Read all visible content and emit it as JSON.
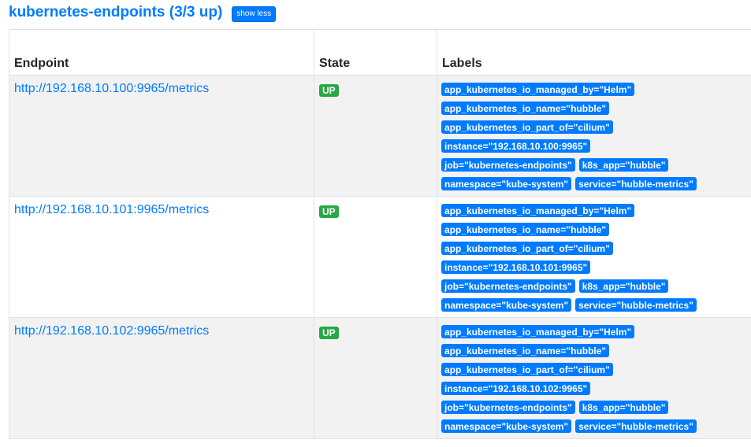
{
  "job": {
    "title": "kubernetes-endpoints (3/3 up)",
    "toggle_label": "show less"
  },
  "table": {
    "headers": {
      "endpoint": "Endpoint",
      "state": "State",
      "labels": "Labels"
    },
    "rows": [
      {
        "endpoint": "http://192.168.10.100:9965/metrics",
        "state": "UP",
        "labels": [
          "app_kubernetes_io_managed_by=\"Helm\"",
          "app_kubernetes_io_name=\"hubble\"",
          "app_kubernetes_io_part_of=\"cilium\"",
          "instance=\"192.168.10.100:9965\"",
          "job=\"kubernetes-endpoints\"",
          "k8s_app=\"hubble\"",
          "namespace=\"kube-system\"",
          "service=\"hubble-metrics\""
        ]
      },
      {
        "endpoint": "http://192.168.10.101:9965/metrics",
        "state": "UP",
        "labels": [
          "app_kubernetes_io_managed_by=\"Helm\"",
          "app_kubernetes_io_name=\"hubble\"",
          "app_kubernetes_io_part_of=\"cilium\"",
          "instance=\"192.168.10.101:9965\"",
          "job=\"kubernetes-endpoints\"",
          "k8s_app=\"hubble\"",
          "namespace=\"kube-system\"",
          "service=\"hubble-metrics\""
        ]
      },
      {
        "endpoint": "http://192.168.10.102:9965/metrics",
        "state": "UP",
        "labels": [
          "app_kubernetes_io_managed_by=\"Helm\"",
          "app_kubernetes_io_name=\"hubble\"",
          "app_kubernetes_io_part_of=\"cilium\"",
          "instance=\"192.168.10.102:9965\"",
          "job=\"kubernetes-endpoints\"",
          "k8s_app=\"hubble\"",
          "namespace=\"kube-system\"",
          "service=\"hubble-metrics\""
        ]
      }
    ]
  },
  "colors": {
    "link": "#007bff",
    "label_badge": "#007bff",
    "state_up": "#28a745",
    "row_stripe": "#f2f2f2"
  }
}
